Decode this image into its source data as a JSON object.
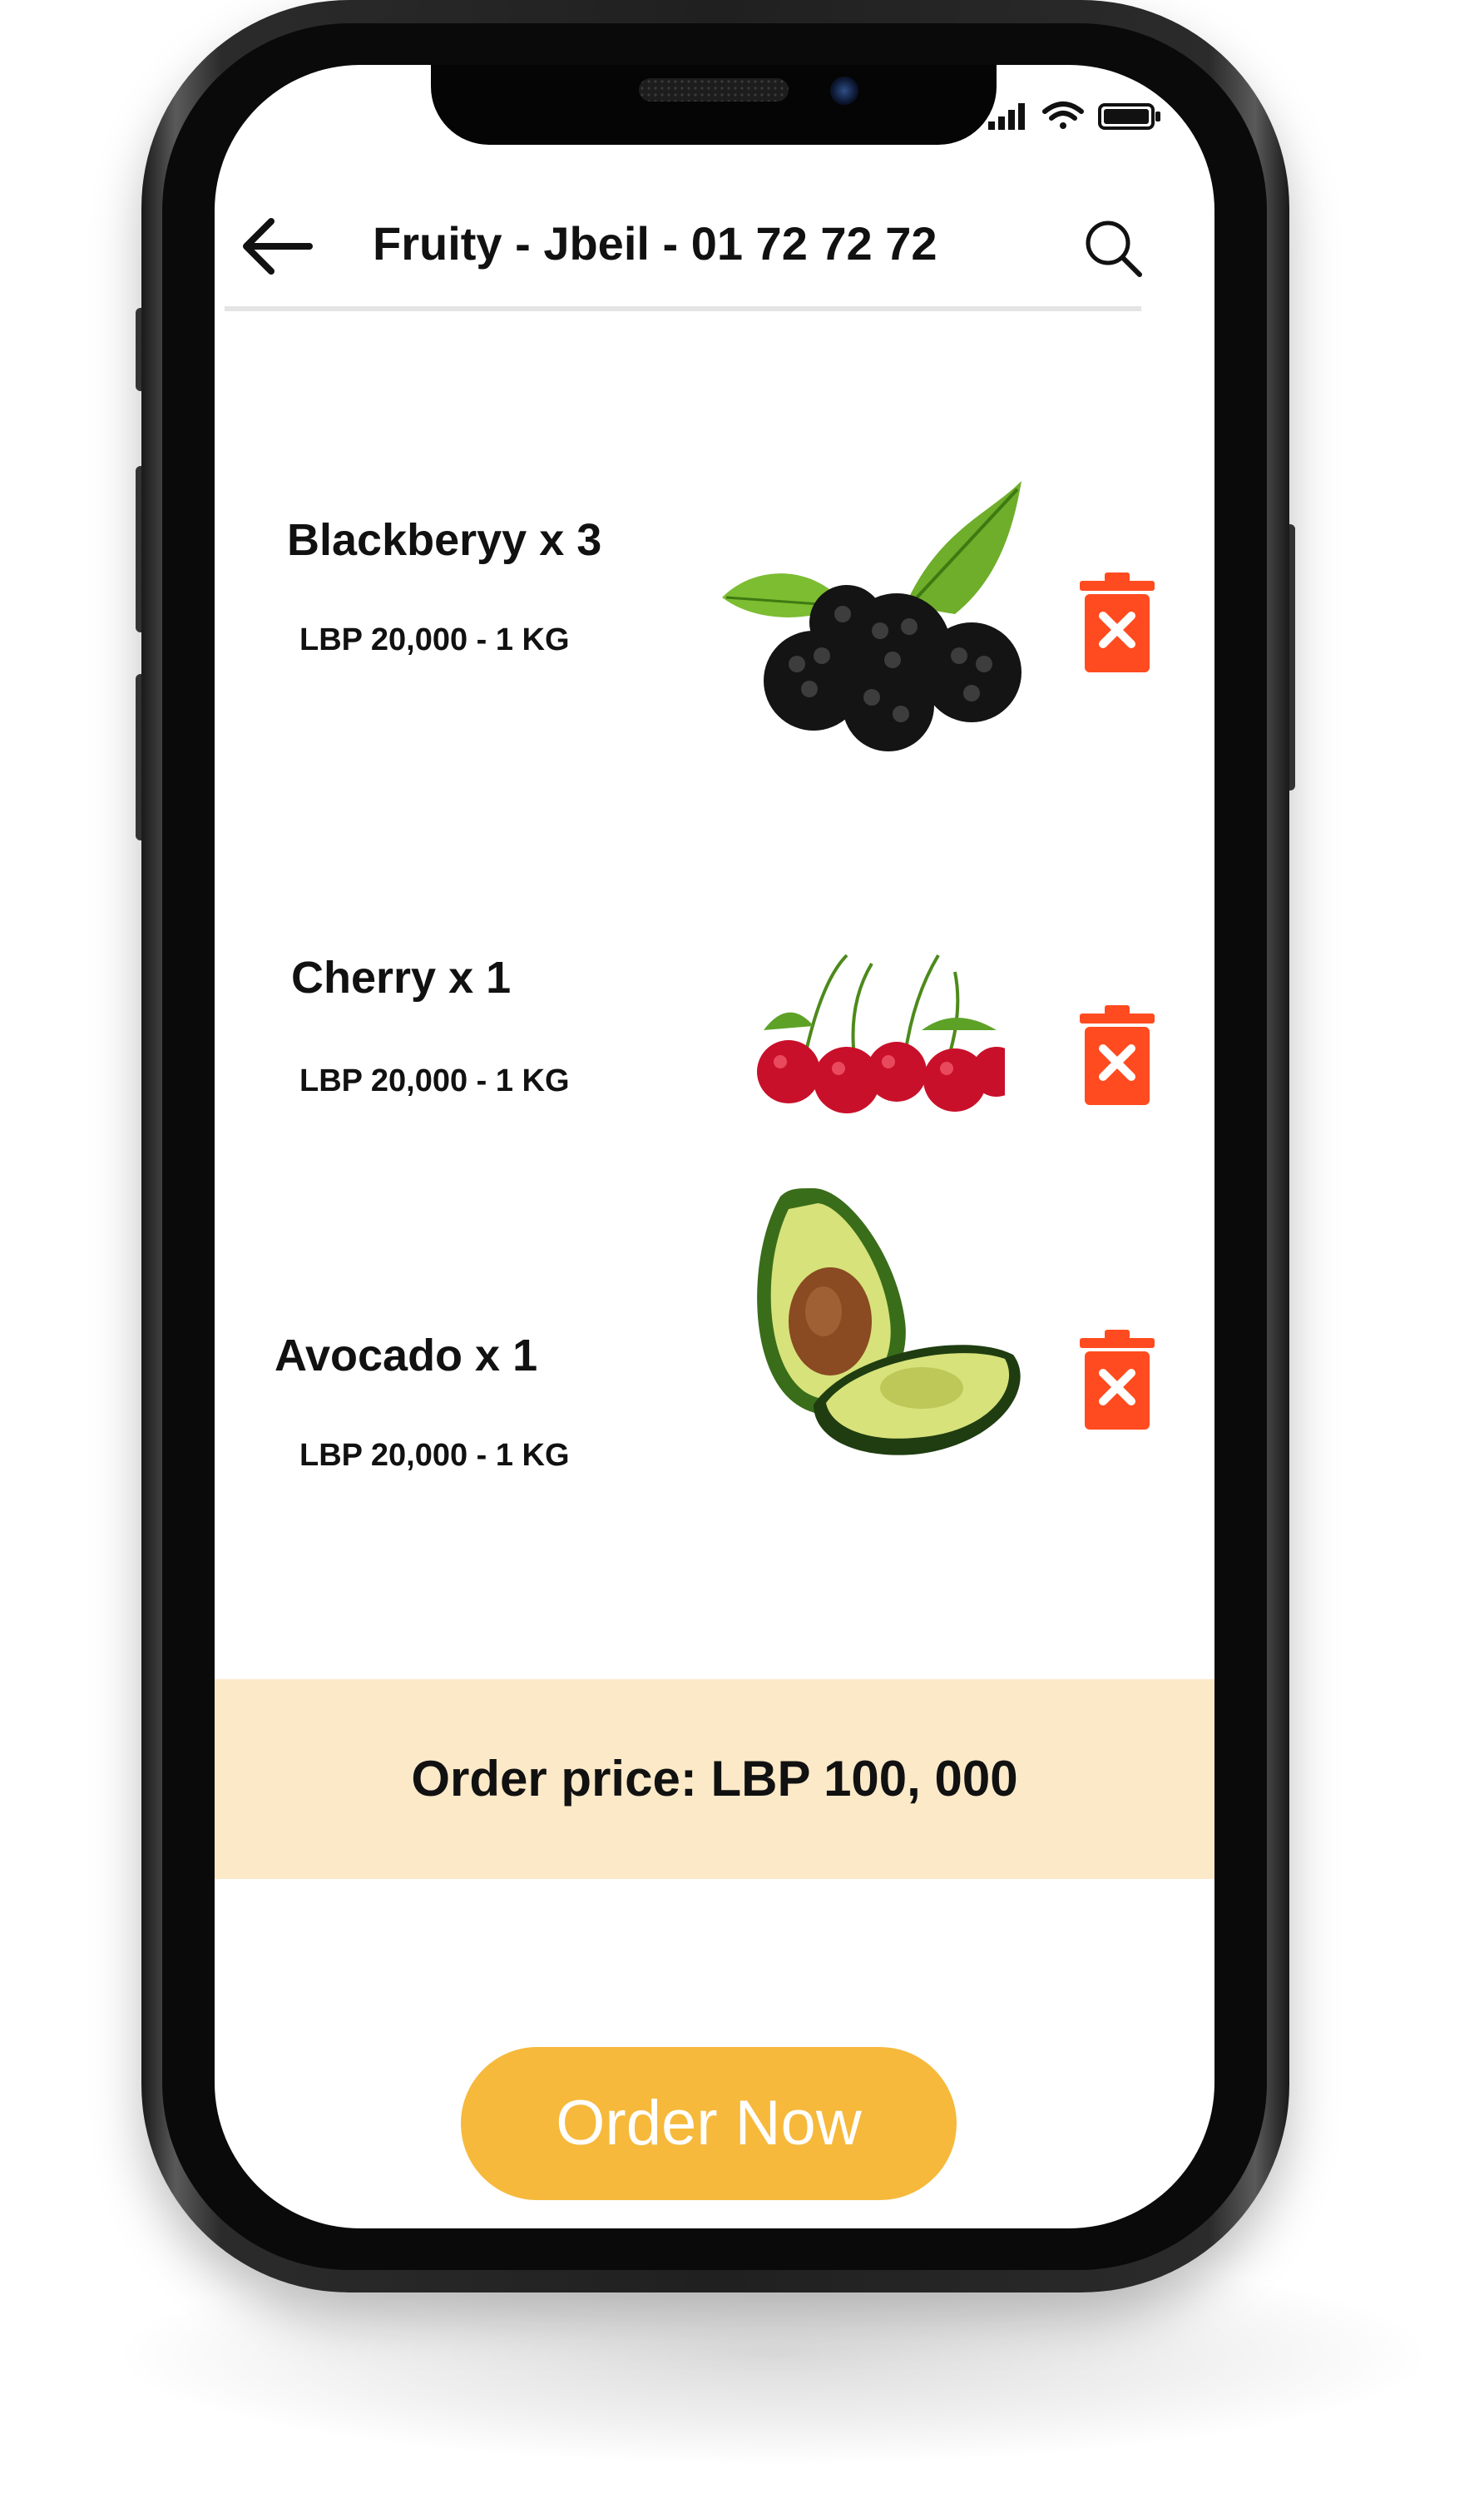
{
  "header": {
    "title": "Fruity - Jbeil - 01 72 72 72",
    "back_icon": "arrow-left-icon",
    "search_icon": "search-icon"
  },
  "status_bar": {
    "icons": [
      "signal-icon",
      "wifi-icon",
      "battery-icon"
    ]
  },
  "cart": {
    "items": [
      {
        "name": "Blackberyy x 3",
        "price": "LBP 20,000 - 1 KG",
        "image": "blackberry-image",
        "delete_icon": "trash-icon"
      },
      {
        "name": "Cherry x 1",
        "price": "LBP 20,000 - 1 KG",
        "image": "cherry-image",
        "delete_icon": "trash-icon"
      },
      {
        "name": "Avocado x 1",
        "price": "LBP 20,000 - 1 KG",
        "image": "avocado-image",
        "delete_icon": "trash-icon"
      }
    ]
  },
  "summary": {
    "total_label": "Order price: LBP 100, 000"
  },
  "actions": {
    "order_label": "Order Now"
  },
  "colors": {
    "accent": "#f6b93b",
    "summary_bg": "#fbe9c8",
    "delete": "#ff4b1f"
  }
}
